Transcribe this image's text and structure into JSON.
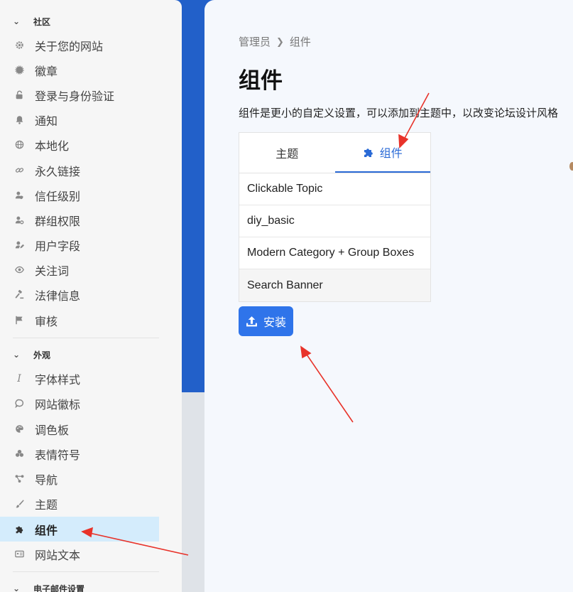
{
  "sidebar": {
    "community_section": "社区",
    "community_items": [
      {
        "label": "关于您的网站",
        "icon": "gear-icon"
      },
      {
        "label": "徽章",
        "icon": "certificate-icon"
      },
      {
        "label": "登录与身份验证",
        "icon": "unlock-icon"
      },
      {
        "label": "通知",
        "icon": "bell-icon"
      },
      {
        "label": "本地化",
        "icon": "globe-icon"
      },
      {
        "label": "永久链接",
        "icon": "link-icon"
      },
      {
        "label": "信任级别",
        "icon": "user-shield-icon"
      },
      {
        "label": "群组权限",
        "icon": "user-gear-icon"
      },
      {
        "label": "用户字段",
        "icon": "user-pen-icon"
      },
      {
        "label": "关注词",
        "icon": "eye-icon"
      },
      {
        "label": "法律信息",
        "icon": "gavel-icon"
      },
      {
        "label": "审核",
        "icon": "flag-icon"
      }
    ],
    "appearance_section": "外观",
    "appearance_items": [
      {
        "label": "字体样式",
        "icon": "italic-icon"
      },
      {
        "label": "网站徽标",
        "icon": "comment-icon"
      },
      {
        "label": "调色板",
        "icon": "palette-icon"
      },
      {
        "label": "表情符号",
        "icon": "emoji-icon"
      },
      {
        "label": "导航",
        "icon": "sitemap-icon"
      },
      {
        "label": "主题",
        "icon": "paintbrush-icon"
      },
      {
        "label": "组件",
        "icon": "puzzle-icon",
        "active": true
      },
      {
        "label": "网站文本",
        "icon": "id-card-icon"
      }
    ],
    "email_section": "电子邮件设置"
  },
  "breadcrumb": {
    "root": "管理员",
    "current": "组件"
  },
  "page": {
    "title": "组件",
    "description": "组件是更小的自定义设置，可以添加到主题中，以改变论坛设计风格"
  },
  "tabs": [
    {
      "label": "主题",
      "active": false
    },
    {
      "label": "组件",
      "active": true,
      "icon": "puzzle-icon"
    }
  ],
  "components": [
    "Clickable Topic",
    "diy_basic",
    "Modern Category + Group Boxes",
    "Search Banner"
  ],
  "install_button": {
    "label": "安装",
    "icon": "upload-icon"
  },
  "colors": {
    "accent": "#2a6ad6",
    "button": "#2f74ea",
    "sidebar_active": "#d4ecfc",
    "annotation_arrow": "#e8332a",
    "brand_blue": "#2260c9"
  }
}
